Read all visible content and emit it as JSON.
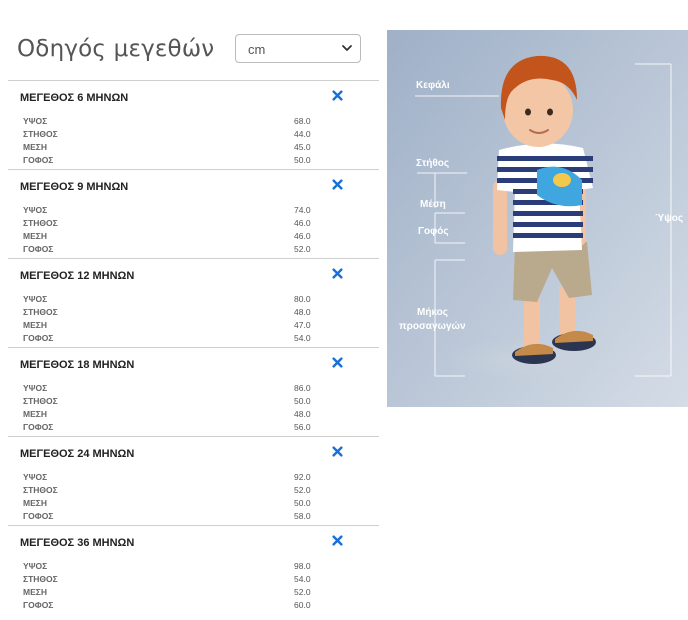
{
  "title": "Οδηγός μεγεθών",
  "unit_select": {
    "value": "cm"
  },
  "sizes": [
    {
      "title": "ΜΕΓΕΘΟΣ 6 ΜΗΝΩΝ",
      "rows": [
        {
          "label": "ΥΨΟΣ",
          "value": "68.0"
        },
        {
          "label": "ΣΤΗΘΟΣ",
          "value": "44.0"
        },
        {
          "label": "ΜΕΣΗ",
          "value": "45.0"
        },
        {
          "label": "ΓΟΦΟΣ",
          "value": "50.0"
        }
      ]
    },
    {
      "title": "ΜΕΓΕΘΟΣ 9 ΜΗΝΩΝ",
      "rows": [
        {
          "label": "ΥΨΟΣ",
          "value": "74.0"
        },
        {
          "label": "ΣΤΗΘΟΣ",
          "value": "46.0"
        },
        {
          "label": "ΜΕΣΗ",
          "value": "46.0"
        },
        {
          "label": "ΓΟΦΟΣ",
          "value": "52.0"
        }
      ]
    },
    {
      "title": "ΜΕΓΕΘΟΣ 12 ΜΗΝΩΝ",
      "rows": [
        {
          "label": "ΥΨΟΣ",
          "value": "80.0"
        },
        {
          "label": "ΣΤΗΘΟΣ",
          "value": "48.0"
        },
        {
          "label": "ΜΕΣΗ",
          "value": "47.0"
        },
        {
          "label": "ΓΟΦΟΣ",
          "value": "54.0"
        }
      ]
    },
    {
      "title": "ΜΕΓΕΘΟΣ 18 ΜΗΝΩΝ",
      "rows": [
        {
          "label": "ΥΨΟΣ",
          "value": "86.0"
        },
        {
          "label": "ΣΤΗΘΟΣ",
          "value": "50.0"
        },
        {
          "label": "ΜΕΣΗ",
          "value": "48.0"
        },
        {
          "label": "ΓΟΦΟΣ",
          "value": "56.0"
        }
      ]
    },
    {
      "title": "ΜΕΓΕΘΟΣ 24 ΜΗΝΩΝ",
      "rows": [
        {
          "label": "ΥΨΟΣ",
          "value": "92.0"
        },
        {
          "label": "ΣΤΗΘΟΣ",
          "value": "52.0"
        },
        {
          "label": "ΜΕΣΗ",
          "value": "50.0"
        },
        {
          "label": "ΓΟΦΟΣ",
          "value": "58.0"
        }
      ]
    },
    {
      "title": "ΜΕΓΕΘΟΣ 36 ΜΗΝΩΝ",
      "rows": [
        {
          "label": "ΥΨΟΣ",
          "value": "98.0"
        },
        {
          "label": "ΣΤΗΘΟΣ",
          "value": "54.0"
        },
        {
          "label": "ΜΕΣΗ",
          "value": "52.0"
        },
        {
          "label": "ΓΟΦΟΣ",
          "value": "60.0"
        }
      ]
    }
  ],
  "photo_labels": {
    "head": "Κεφάλι",
    "chest": "Στήθος",
    "waist": "Μέση",
    "hip": "Γοφός",
    "inseam_1": "Μήκος",
    "inseam_2": "προσαγωγών",
    "height": "Ύψος"
  },
  "colors": {
    "close_icon": "#1a6fd6",
    "photo_bg": "#b7c4d6"
  }
}
